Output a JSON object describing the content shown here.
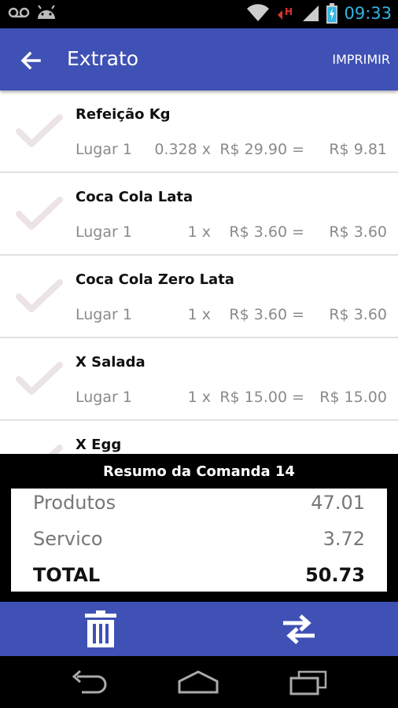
{
  "status_bar": {
    "time": "09:33",
    "icons": [
      "voicemail-icon",
      "android-icon",
      "wifi-icon",
      "h-signal-icon",
      "cell-signal-icon",
      "battery-charging-icon"
    ],
    "h_label": "H"
  },
  "app_bar": {
    "title": "Extrato",
    "print_label": "IMPRIMIR",
    "color": "#3f51b5"
  },
  "items": [
    {
      "name": "Refeição Kg",
      "place": "Lugar 1",
      "qty": "0.328 x",
      "price": "R$ 29.90 =",
      "total": "R$ 9.81"
    },
    {
      "name": "Coca Cola Lata",
      "place": "Lugar 1",
      "qty": "1 x",
      "price": "R$ 3.60 =",
      "total": "R$ 3.60"
    },
    {
      "name": "Coca Cola Zero Lata",
      "place": "Lugar 1",
      "qty": "1 x",
      "price": "R$ 3.60 =",
      "total": "R$ 3.60"
    },
    {
      "name": "X Salada",
      "place": "Lugar 1",
      "qty": "1 x",
      "price": "R$ 15.00 =",
      "total": "R$ 15.00"
    },
    {
      "name": "X Egg",
      "place": "",
      "qty": "",
      "price": "",
      "total": ""
    }
  ],
  "summary": {
    "title": "Resumo da Comanda 14",
    "products_label": "Produtos",
    "products_value": "47.01",
    "service_label": "Servico",
    "service_value": "3.72",
    "total_label": "TOTAL",
    "total_value": "50.73"
  },
  "actions": {
    "delete_icon": "trash-icon",
    "transfer_icon": "swap-arrows-icon"
  },
  "nav": {
    "icons": [
      "back-nav-icon",
      "home-nav-icon",
      "recents-nav-icon"
    ]
  }
}
